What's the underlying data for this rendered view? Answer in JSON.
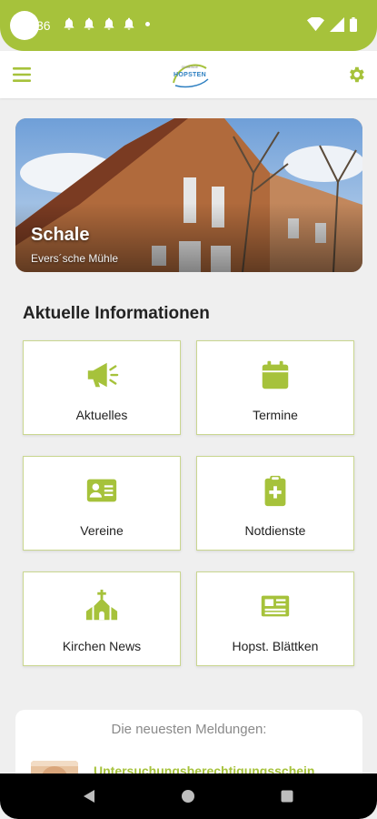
{
  "status_bar": {
    "time": "36",
    "icons": [
      "bell-icon",
      "bell-icon",
      "bell-icon",
      "bell-icon",
      "dot-icon",
      "wifi-icon",
      "signal-icon",
      "battery-icon"
    ]
  },
  "app_bar": {
    "logo_small_text": "GEMEINDE",
    "logo_text": "HOPSTEN",
    "menu_icon": "hamburger-menu-icon",
    "settings_icon": "gear-icon"
  },
  "hero": {
    "title": "Schale",
    "subtitle": "Evers´sche Mühle"
  },
  "section": {
    "title": "Aktuelle Informationen"
  },
  "tiles": [
    {
      "label": "Aktuelles",
      "icon": "megaphone-icon"
    },
    {
      "label": "Termine",
      "icon": "calendar-icon"
    },
    {
      "label": "Vereine",
      "icon": "id-card-icon"
    },
    {
      "label": "Notdienste",
      "icon": "medical-clipboard-icon"
    },
    {
      "label": "Kirchen News",
      "icon": "church-icon"
    },
    {
      "label": "Hopst. Blättken",
      "icon": "newspaper-icon"
    }
  ],
  "news": {
    "heading": "Die neuesten Meldungen:",
    "first_item": "Untersuchungsberechtigungsschein"
  },
  "colors": {
    "accent": "#a6c23b",
    "background": "#efefef",
    "tile_border": "#c9d68f"
  }
}
